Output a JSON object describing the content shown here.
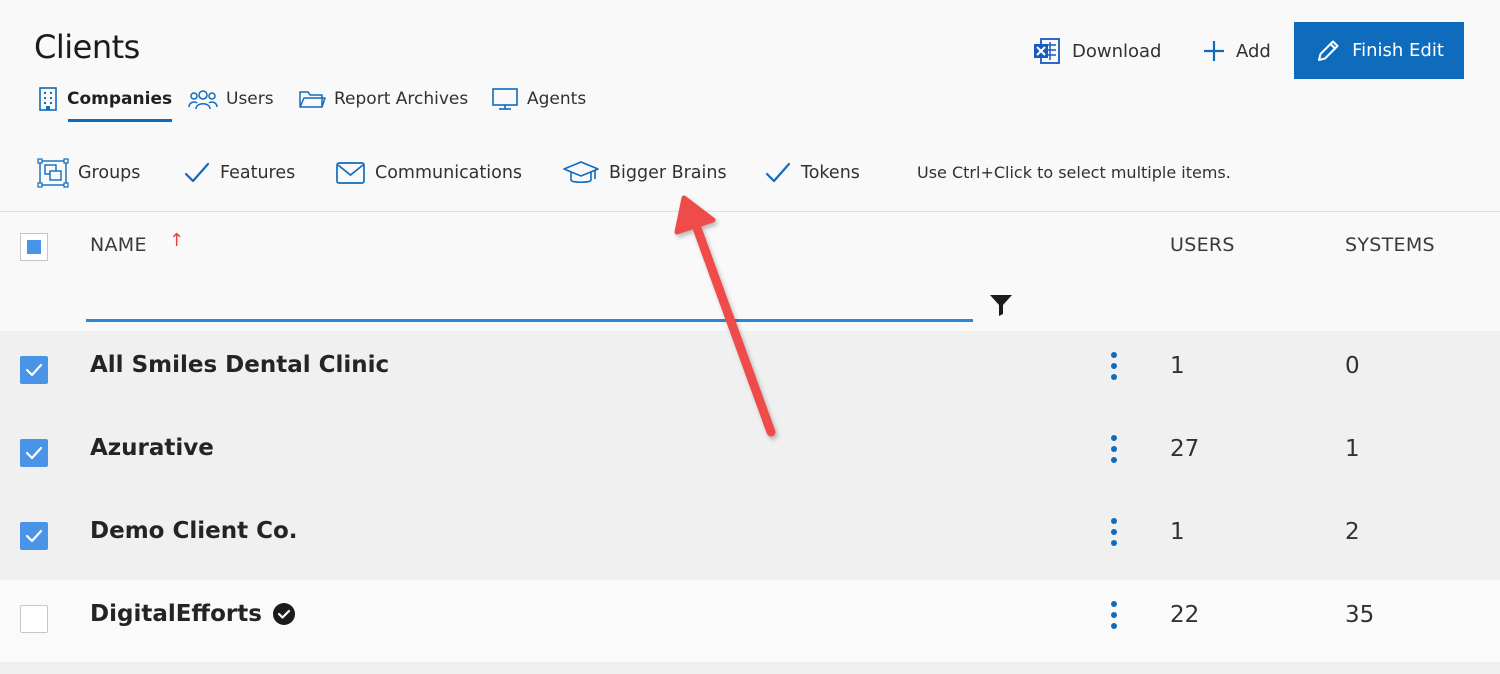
{
  "page": {
    "title": "Clients"
  },
  "header_actions": {
    "download_label": "Download",
    "add_label": "Add",
    "finish_edit_label": "Finish Edit"
  },
  "tabs": [
    {
      "label": "Companies",
      "icon": "building-icon",
      "active": true
    },
    {
      "label": "Users",
      "icon": "people-icon",
      "active": false
    },
    {
      "label": "Report Archives",
      "icon": "folder-icon",
      "active": false
    },
    {
      "label": "Agents",
      "icon": "monitor-icon",
      "active": false
    }
  ],
  "toolbar": {
    "items": [
      {
        "label": "Groups",
        "icon": "groups-icon"
      },
      {
        "label": "Features",
        "icon": "checkmark-icon"
      },
      {
        "label": "Communications",
        "icon": "mail-icon"
      },
      {
        "label": "Bigger Brains",
        "icon": "graduation-cap-icon"
      },
      {
        "label": "Tokens",
        "icon": "checkmark-icon"
      }
    ],
    "hint": "Use Ctrl+Click to select multiple items."
  },
  "table": {
    "columns": {
      "name": "NAME",
      "users": "USERS",
      "systems": "SYSTEMS"
    },
    "sort_indicator": "↑",
    "filter_value": "",
    "rows": [
      {
        "name": "All Smiles Dental Clinic",
        "users": "1",
        "systems": "0",
        "checked": true,
        "verified": false
      },
      {
        "name": "Azurative",
        "users": "27",
        "systems": "1",
        "checked": true,
        "verified": false
      },
      {
        "name": "Demo Client Co.",
        "users": "1",
        "systems": "2",
        "checked": true,
        "verified": false
      },
      {
        "name": "DigitalEfforts",
        "users": "22",
        "systems": "35",
        "checked": false,
        "verified": true
      }
    ]
  },
  "colors": {
    "accent": "#0f6cbd",
    "checkbox": "#4a94e8",
    "annotation_arrow": "#e8453c"
  }
}
